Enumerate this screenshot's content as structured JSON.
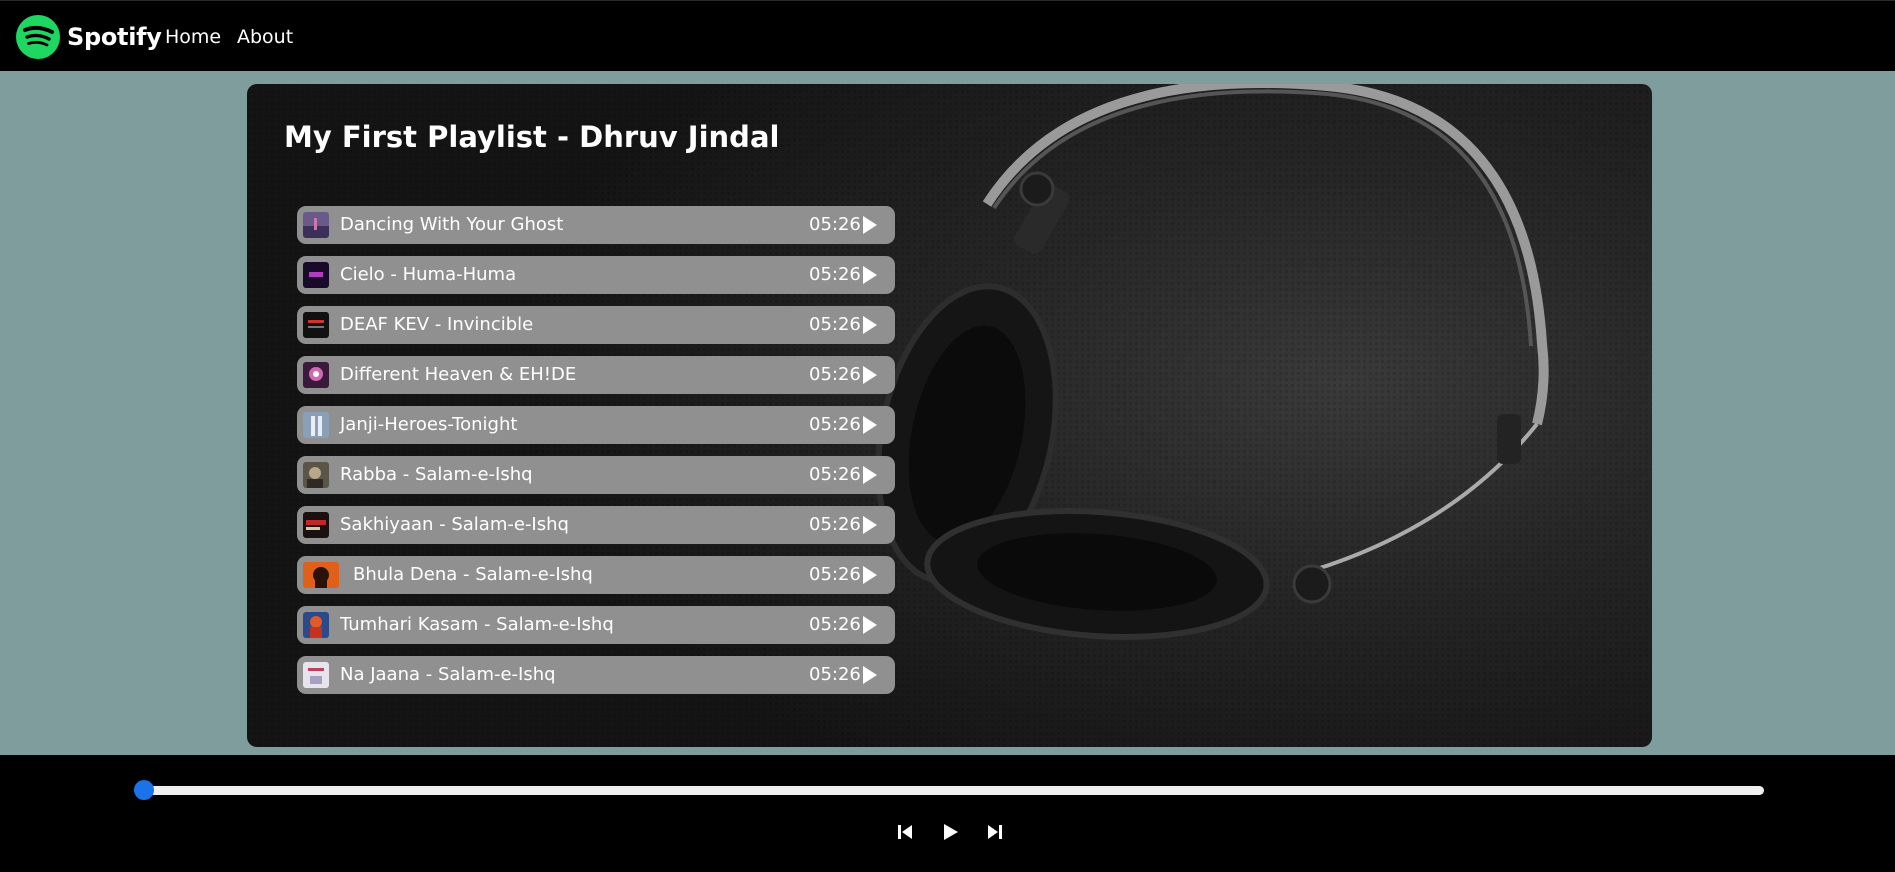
{
  "brand": {
    "name": "Spotify",
    "logo_icon": "spotify-logo-icon",
    "accent": "#1ed760"
  },
  "nav": {
    "home_label": "Home",
    "about_label": "About"
  },
  "playlist": {
    "title": "My First Playlist - Dhruv Jindal",
    "songs": [
      {
        "name": "Dancing With Your Ghost",
        "duration": "05:26"
      },
      {
        "name": "Cielo - Huma-Huma",
        "duration": "05:26"
      },
      {
        "name": "DEAF KEV - Invincible",
        "duration": "05:26"
      },
      {
        "name": "Different Heaven & EH!DE",
        "duration": "05:26"
      },
      {
        "name": "Janji-Heroes-Tonight",
        "duration": "05:26"
      },
      {
        "name": "Rabba - Salam-e-Ishq",
        "duration": "05:26"
      },
      {
        "name": "Sakhiyaan - Salam-e-Ishq",
        "duration": "05:26"
      },
      {
        "name": "Bhula Dena - Salam-e-Ishq",
        "duration": "05:26"
      },
      {
        "name": "Tumhari Kasam - Salam-e-Ishq",
        "duration": "05:26"
      },
      {
        "name": "Na Jaana - Salam-e-Ishq",
        "duration": "05:26"
      }
    ]
  },
  "player": {
    "progress": 0,
    "controls": [
      "previous-icon",
      "play-icon",
      "next-icon"
    ],
    "slider_color": "#1a73e8"
  }
}
